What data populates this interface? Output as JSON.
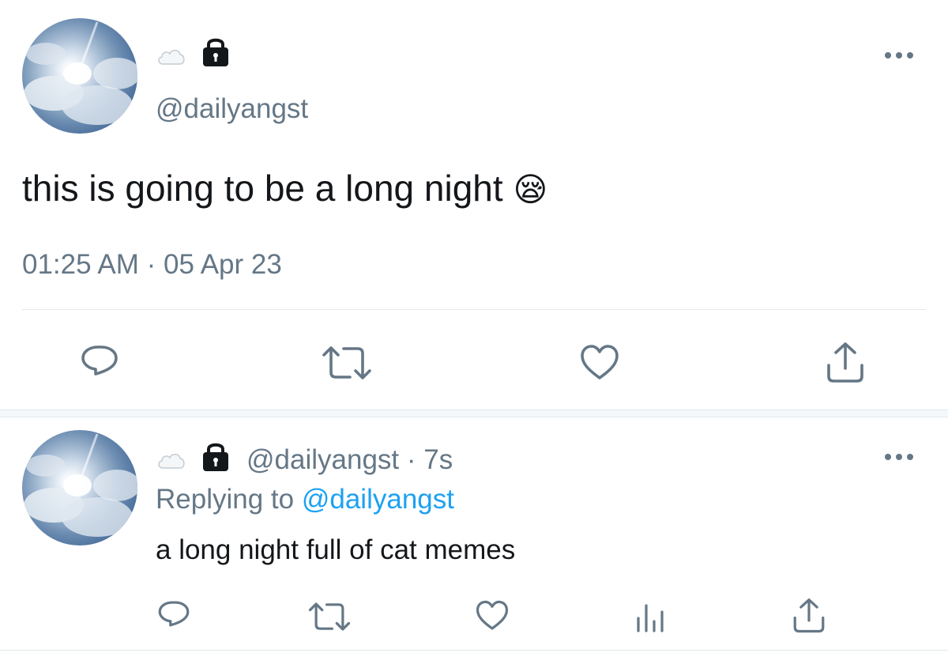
{
  "main_tweet": {
    "handle": "@dailyangst",
    "text": "this is going to be a long night",
    "emoji": "😪",
    "timestamp": "01:25 AM · 05 Apr 23",
    "name_icons": [
      "cloud-icon",
      "lock-icon"
    ],
    "actions": [
      "reply-icon",
      "retweet-icon",
      "like-icon",
      "share-icon"
    ]
  },
  "reply_tweet": {
    "handle": "@dailyangst",
    "separator": "·",
    "time": "7s",
    "replying_prefix": "Replying to",
    "replying_to": "@dailyangst",
    "text": "a long night full of cat memes",
    "name_icons": [
      "cloud-icon",
      "lock-icon"
    ],
    "actions": [
      "reply-icon",
      "retweet-icon",
      "like-icon",
      "analytics-icon",
      "share-icon"
    ]
  },
  "colors": {
    "text": "#14171a",
    "secondary": "#657786",
    "link": "#1da1f2",
    "divider": "#e1e8ed"
  }
}
